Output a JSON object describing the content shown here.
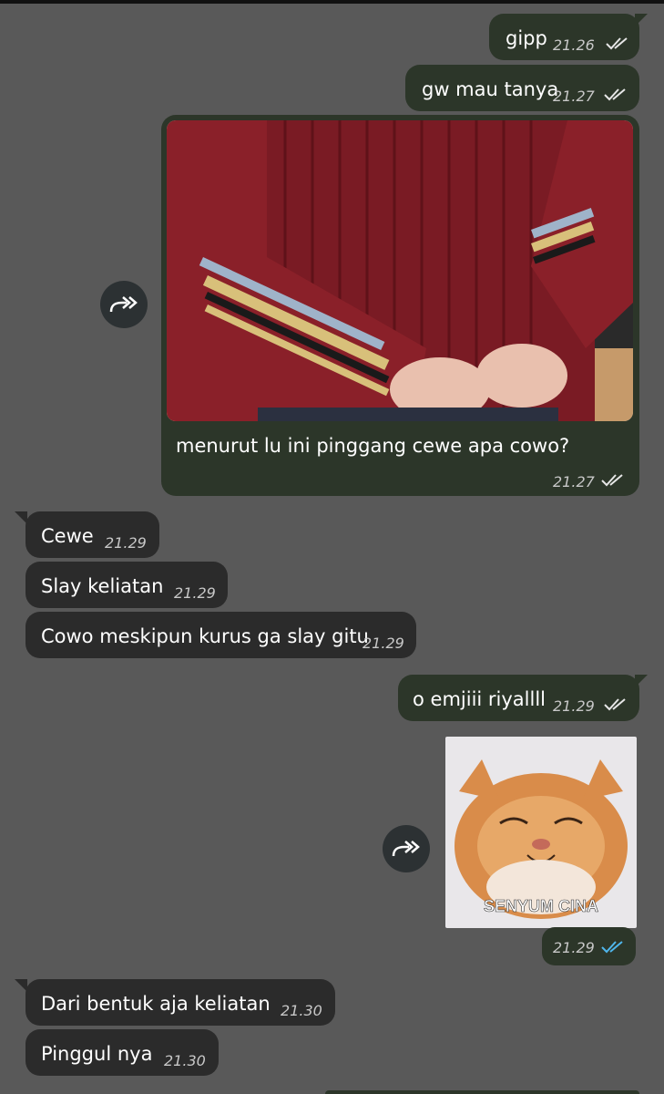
{
  "messages": [
    {
      "id": "m1",
      "dir": "out",
      "text": "gipp",
      "time": "21.26"
    },
    {
      "id": "m2",
      "dir": "out",
      "text": "gw mau tanya",
      "time": "21.27"
    },
    {
      "id": "m3",
      "dir": "out",
      "text": "menurut lu ini pinggang cewe apa cowo?",
      "time": "21.27"
    },
    {
      "id": "m4",
      "dir": "in",
      "text": "Cewe",
      "time": "21.29"
    },
    {
      "id": "m5",
      "dir": "in",
      "text": "Slay keliatan",
      "time": "21.29"
    },
    {
      "id": "m6",
      "dir": "in",
      "text": "Cowo meskipun kurus ga slay gitu",
      "time": "21.29"
    },
    {
      "id": "m7",
      "dir": "out",
      "text": "o emjiii riyallll",
      "time": "21.29"
    },
    {
      "id": "m8",
      "dir": "out",
      "sticker_caption": "SENYUM CINA",
      "time": "21.29"
    },
    {
      "id": "m9",
      "dir": "in",
      "text": "Dari bentuk aja keliatan",
      "time": "21.30"
    },
    {
      "id": "m10",
      "dir": "in",
      "text": "Pinggul nya",
      "time": "21.30"
    }
  ],
  "colors": {
    "background": "#595959",
    "outgoing_bubble": "#2c3629",
    "incoming_bubble": "#2b2b2b",
    "read_ticks_blue": "#4fb6ec",
    "sent_ticks": "#e6e6e6"
  },
  "icons": {
    "forward": "forward-arrow-icon",
    "ticks": "double-check-icon"
  }
}
